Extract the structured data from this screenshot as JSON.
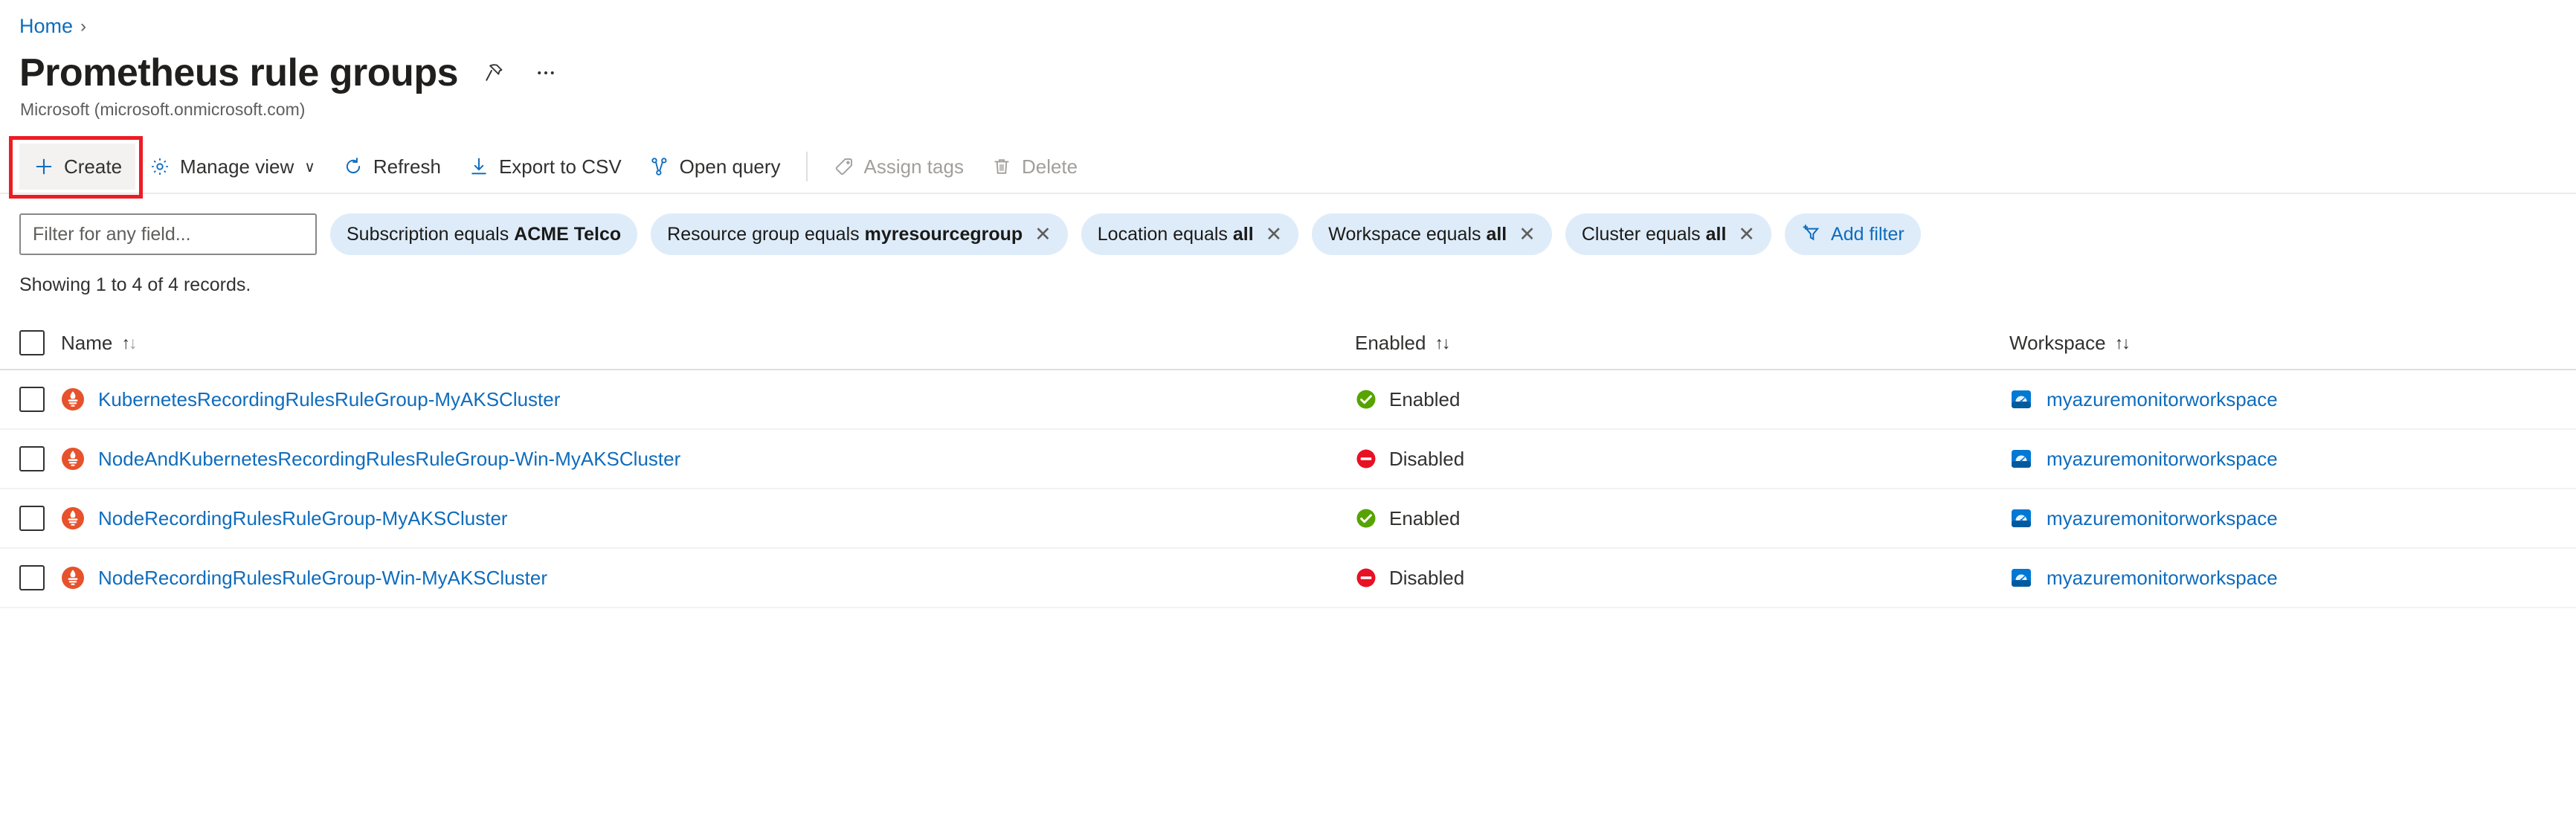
{
  "breadcrumb": {
    "home": "Home",
    "separator": "›"
  },
  "header": {
    "title": "Prometheus rule groups",
    "subtitle": "Microsoft (microsoft.onmicrosoft.com)",
    "pin_icon": "pin-icon",
    "more_icon": "ellipsis-icon"
  },
  "toolbar": {
    "create": "Create",
    "manage_view": "Manage view",
    "refresh": "Refresh",
    "export_csv": "Export to CSV",
    "open_query": "Open query",
    "assign_tags": "Assign tags",
    "delete": "Delete",
    "chevron": "∨"
  },
  "filters": {
    "search_placeholder": "Filter for any field...",
    "search_value": "",
    "pills": [
      {
        "label": "Subscription equals",
        "value": "ACME Telco",
        "removable": false
      },
      {
        "label": "Resource group equals",
        "value": "myresourcegroup",
        "removable": true
      },
      {
        "label": "Location equals",
        "value": "all",
        "removable": true
      },
      {
        "label": "Workspace equals",
        "value": "all",
        "removable": true
      },
      {
        "label": "Cluster equals",
        "value": "all",
        "removable": true
      }
    ],
    "add_filter": "Add filter",
    "remove_glyph": "✕"
  },
  "records_summary": "Showing 1 to 4 of 4 records.",
  "table": {
    "columns": [
      {
        "key": "name",
        "label": "Name"
      },
      {
        "key": "enabled",
        "label": "Enabled"
      },
      {
        "key": "workspace",
        "label": "Workspace"
      }
    ],
    "rows": [
      {
        "name": "KubernetesRecordingRulesRuleGroup-MyAKSCluster",
        "enabled": "Enabled",
        "enabled_state": "enabled",
        "workspace": "myazuremonitorworkspace"
      },
      {
        "name": "NodeAndKubernetesRecordingRulesRuleGroup-Win-MyAKSCluster",
        "enabled": "Disabled",
        "enabled_state": "disabled",
        "workspace": "myazuremonitorworkspace"
      },
      {
        "name": "NodeRecordingRulesRuleGroup-MyAKSCluster",
        "enabled": "Enabled",
        "enabled_state": "enabled",
        "workspace": "myazuremonitorworkspace"
      },
      {
        "name": "NodeRecordingRulesRuleGroup-Win-MyAKSCluster",
        "enabled": "Disabled",
        "enabled_state": "disabled",
        "workspace": "myazuremonitorworkspace"
      }
    ]
  },
  "colors": {
    "link": "#0f6cbd",
    "pill_bg": "#deecf9",
    "enabled_green": "#57a300",
    "disabled_red": "#e81123",
    "prometheus_orange": "#e6522c",
    "highlight_red": "#ec1c24"
  }
}
